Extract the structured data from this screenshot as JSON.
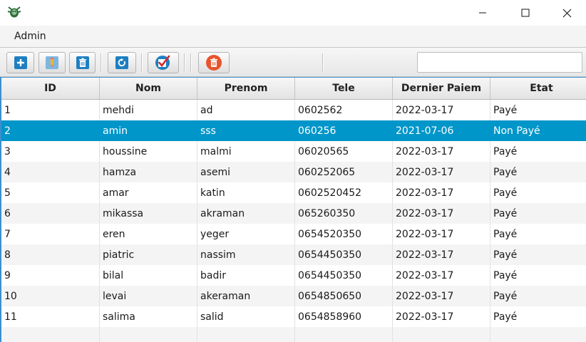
{
  "menu": {
    "admin_label": "Admin"
  },
  "search": {
    "value": "",
    "placeholder": ""
  },
  "toolbar": {
    "buttons": [
      {
        "icon": "add-icon"
      },
      {
        "icon": "edit-icon"
      },
      {
        "icon": "trash-icon"
      },
      {
        "icon": "refresh-icon"
      },
      {
        "icon": "check-icon"
      },
      {
        "icon": "delete-circle-icon"
      }
    ]
  },
  "table": {
    "columns": [
      "ID",
      "Nom",
      "Prenom",
      "Tele",
      "Dernier Paiem",
      "Etat"
    ],
    "selected_index": 1,
    "rows": [
      [
        "1",
        "mehdi",
        "ad",
        "0602562",
        "2022-03-17",
        "Payé"
      ],
      [
        "2",
        "amin",
        "sss",
        "060256",
        "2021-07-06",
        "Non Payé"
      ],
      [
        "3",
        "houssine",
        "malmi",
        "06020565",
        "2022-03-17",
        "Payé"
      ],
      [
        "4",
        "hamza",
        "asemi",
        "060252065",
        "2022-03-17",
        "Payé"
      ],
      [
        "5",
        "amar",
        "katin",
        "0602520452",
        "2022-03-17",
        "Payé"
      ],
      [
        "6",
        "mikassa",
        "akraman",
        "065260350",
        "2022-03-17",
        "Payé"
      ],
      [
        "7",
        "eren",
        "yeger",
        "0654520350",
        "2022-03-17",
        "Payé"
      ],
      [
        "8",
        "piatric",
        "nassim",
        "0654450350",
        "2022-03-17",
        "Payé"
      ],
      [
        "9",
        "bilal",
        "badir",
        "0654450350",
        "2022-03-17",
        "Payé"
      ],
      [
        "10",
        "levai",
        "akeraman",
        "0654850650",
        "2022-03-17",
        "Payé"
      ],
      [
        "11",
        "salima",
        "salid",
        "0654858960",
        "2022-03-17",
        "Payé"
      ]
    ]
  },
  "colors": {
    "selection": "#0096c9",
    "accent_border": "#3c8fd0",
    "button_blue": "#1e7fc0",
    "button_red": "#e8542c"
  }
}
